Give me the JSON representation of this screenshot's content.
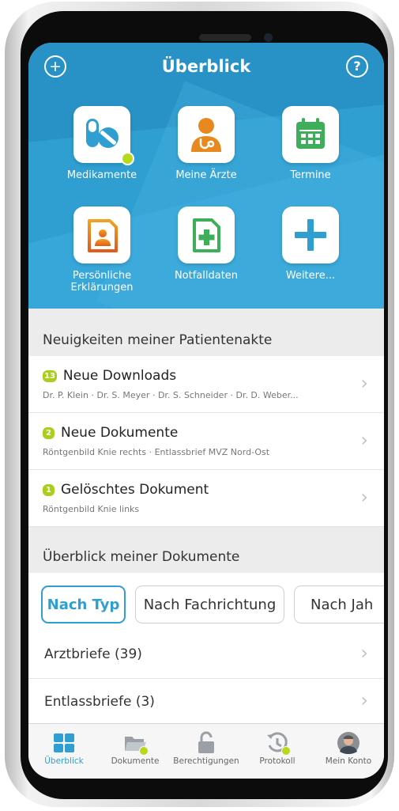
{
  "header": {
    "title": "Überblick"
  },
  "tiles": [
    {
      "label": "Medikamente"
    },
    {
      "label": "Meine Ärzte"
    },
    {
      "label": "Termine"
    },
    {
      "label_line1": "Persönliche",
      "label_line2": "Erklärungen"
    },
    {
      "label": "Notfalldaten"
    },
    {
      "label": "Weitere..."
    }
  ],
  "news": {
    "heading": "Neuigkeiten meiner Patientenakte",
    "items": [
      {
        "badge": "13",
        "title": "Neue Downloads",
        "subtitle": "Dr. P. Klein · Dr. S. Meyer · Dr. S. Schneider · Dr. D. Weber..."
      },
      {
        "badge": "2",
        "title": "Neue Dokumente",
        "subtitle": "Röntgenbild Knie rechts · Entlassbrief MVZ Nord-Ost"
      },
      {
        "badge": "1",
        "title": "Gelöschtes Dokument",
        "subtitle": "Röntgenbild Knie links"
      }
    ]
  },
  "documents": {
    "heading": "Überblick meiner Dokumente",
    "filters": [
      "Nach Typ",
      "Nach Fachrichtung",
      "Nach Jah"
    ],
    "selected_filter": "Nach Typ",
    "rows": [
      {
        "label": "Arztbriefe (39)"
      },
      {
        "label": "Entlassbriefe (3)"
      }
    ]
  },
  "tabbar": {
    "items": [
      {
        "label": "Überblick",
        "icon": "grid-icon",
        "active": true
      },
      {
        "label": "Dokumente",
        "icon": "folder-icon"
      },
      {
        "label": "Berechtigungen",
        "icon": "lock-open-icon"
      },
      {
        "label": "Protokoll",
        "icon": "history-icon"
      },
      {
        "label": "Mein Konto",
        "icon": "avatar"
      }
    ]
  },
  "colors": {
    "accent": "#2f9ed0",
    "badge": "#a9cf1c",
    "notify_dot": "#b8d81e"
  }
}
